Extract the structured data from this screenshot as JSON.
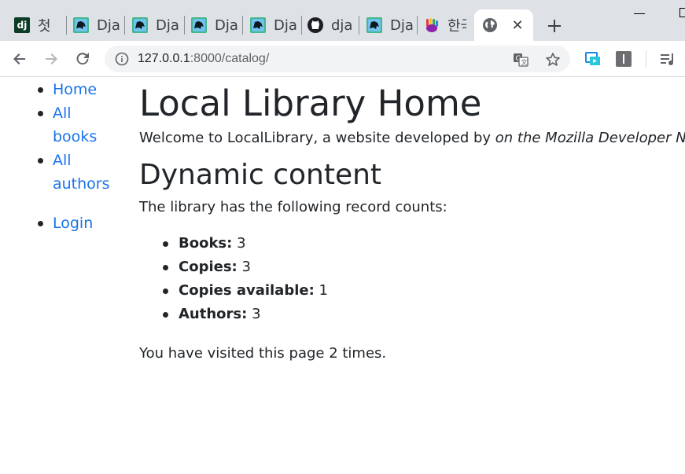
{
  "browser": {
    "tabs": [
      {
        "favicon": "django-dj-icon",
        "title": "첫"
      },
      {
        "favicon": "django-pony-icon",
        "title": "Dja"
      },
      {
        "favicon": "django-pony-icon",
        "title": "Dja"
      },
      {
        "favicon": "django-pony-icon",
        "title": "Dja"
      },
      {
        "favicon": "django-pony-icon",
        "title": "Dja"
      },
      {
        "favicon": "github-icon",
        "title": "dja"
      },
      {
        "favicon": "django-pony-icon",
        "title": "Dja"
      },
      {
        "favicon": "colorful-hand-icon",
        "title": "한국"
      },
      {
        "favicon": "globe-icon",
        "title": "",
        "active": true
      }
    ],
    "dj_favicon_text": "dj",
    "url_host": "127.0.0.1",
    "url_path": ":8000/catalog/"
  },
  "sidebar": {
    "home": "Home",
    "all_books": "All books",
    "all_authors": "All authors",
    "login": "Login"
  },
  "main": {
    "title": "Local Library Home",
    "intro_text": "Welcome to LocalLibrary, a website developed by ",
    "intro_em": "on the Mozilla Developer Network",
    "dynamic_heading": "Dynamic content",
    "counts_intro": "The library has the following record counts:",
    "counts": {
      "books_label": "Books:",
      "books_value": "3",
      "copies_label": "Copies:",
      "copies_value": "3",
      "available_label": "Copies available:",
      "available_value": "1",
      "authors_label": "Authors:",
      "authors_value": "3"
    },
    "visits_text": "You have visited this page 2 times."
  },
  "colors": {
    "link": "#1a73e8",
    "text": "#212529",
    "tabstrip": "#dee1e6",
    "omnibox": "#f1f3f4"
  }
}
